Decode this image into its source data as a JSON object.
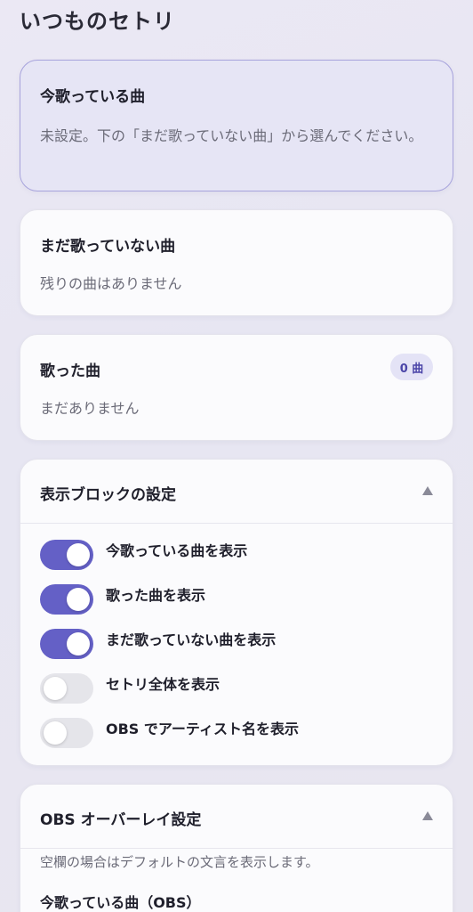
{
  "page": {
    "title": "いつものセトリ"
  },
  "now_playing": {
    "title": "今歌っている曲",
    "status": "未設定。下の「まだ歌っていない曲」から選んでください。"
  },
  "unsung": {
    "title": "まだ歌っていない曲",
    "empty": "残りの曲はありません"
  },
  "sung": {
    "title": "歌った曲",
    "count": "0 曲",
    "empty": "まだありません"
  },
  "display_blocks": {
    "title": "表示ブロックの設定",
    "toggles": [
      {
        "label": "今歌っている曲を表示",
        "on": true
      },
      {
        "label": "歌った曲を表示",
        "on": true
      },
      {
        "label": "まだ歌っていない曲を表示",
        "on": true
      },
      {
        "label": "セトリ全体を表示",
        "on": false
      },
      {
        "label": "OBS でアーティスト名を表示",
        "on": false
      }
    ]
  },
  "obs_overlay": {
    "title": "OBS オーバーレイ設定",
    "hint": "空欄の場合はデフォルトの文言を表示します。",
    "field_label": "今歌っている曲（OBS）"
  },
  "colors": {
    "accent": "#6460c6",
    "badge_bg": "#e4e3f6",
    "highlight_bg": "#e6e5f5"
  }
}
